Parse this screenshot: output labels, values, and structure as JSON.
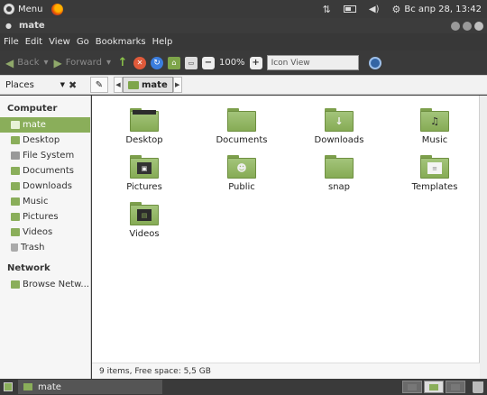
{
  "top_panel": {
    "menu_label": "Menu",
    "clock": "Вс апр 28, 13:42"
  },
  "window": {
    "title": "mate"
  },
  "menubar": [
    "File",
    "Edit",
    "View",
    "Go",
    "Bookmarks",
    "Help"
  ],
  "toolbar": {
    "back_label": "Back",
    "forward_label": "Forward",
    "zoom_level": "100%",
    "view_mode": "Icon View"
  },
  "location": {
    "pane_select": "Places",
    "crumb": "mate"
  },
  "sidebar": {
    "computer_header": "Computer",
    "computer_items": [
      {
        "label": "mate"
      },
      {
        "label": "Desktop"
      },
      {
        "label": "File System"
      },
      {
        "label": "Documents"
      },
      {
        "label": "Downloads"
      },
      {
        "label": "Music"
      },
      {
        "label": "Pictures"
      },
      {
        "label": "Videos"
      },
      {
        "label": "Trash"
      }
    ],
    "network_header": "Network",
    "network_items": [
      {
        "label": "Browse Netw..."
      }
    ]
  },
  "files": [
    {
      "name": "Desktop",
      "icon": "desktop-folder-icon"
    },
    {
      "name": "Documents",
      "icon": "documents-folder-icon"
    },
    {
      "name": "Downloads",
      "icon": "downloads-folder-icon"
    },
    {
      "name": "Music",
      "icon": "music-folder-icon"
    },
    {
      "name": "Pictures",
      "icon": "pictures-folder-icon"
    },
    {
      "name": "Public",
      "icon": "public-folder-icon"
    },
    {
      "name": "snap",
      "icon": "folder-icon"
    },
    {
      "name": "Templates",
      "icon": "templates-folder-icon"
    },
    {
      "name": "Videos",
      "icon": "videos-folder-icon"
    }
  ],
  "status": "9 items, Free space: 5,5 GB",
  "taskbar": {
    "task_label": "mate"
  },
  "colors": {
    "accent": "#8aae5a",
    "panel": "#3a3a3a"
  }
}
